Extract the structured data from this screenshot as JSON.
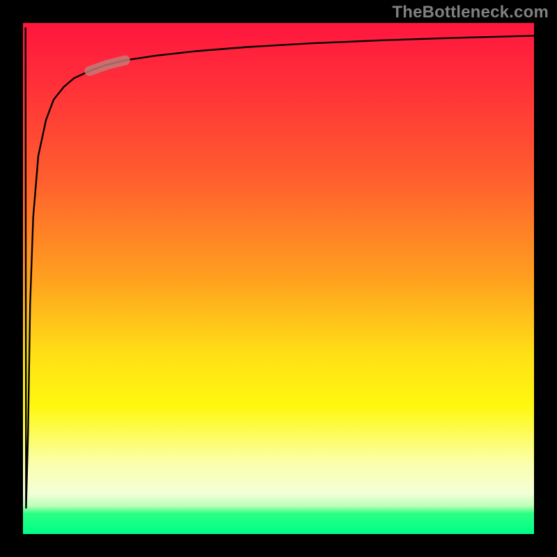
{
  "watermark": "TheBottleneck.com",
  "chart_data": {
    "type": "line",
    "title": "",
    "xlabel": "",
    "ylabel": "",
    "xlim": [
      0,
      100
    ],
    "ylim": [
      0,
      100
    ],
    "gradient_stops": [
      {
        "pos": 0,
        "color": "#ff163e"
      },
      {
        "pos": 30,
        "color": "#ff5d2f"
      },
      {
        "pos": 50,
        "color": "#ffa01f"
      },
      {
        "pos": 75,
        "color": "#fff80e"
      },
      {
        "pos": 92,
        "color": "#f4ffd8"
      },
      {
        "pos": 96,
        "color": "#2bff84"
      },
      {
        "pos": 100,
        "color": "#00ff88"
      }
    ],
    "series": [
      {
        "name": "main-curve",
        "x": [
          0.5,
          0.6,
          1.0,
          1.4,
          2.0,
          3.0,
          4.5,
          6.0,
          8.0,
          10,
          13,
          16,
          20,
          26,
          34,
          44,
          56,
          70,
          85,
          100
        ],
        "y": [
          99.0,
          5.0,
          20.0,
          45.0,
          62.0,
          74.0,
          81.0,
          85.0,
          87.5,
          89.2,
          90.6,
          91.7,
          92.7,
          93.6,
          94.5,
          95.3,
          96.0,
          96.6,
          97.1,
          97.5
        ]
      }
    ],
    "highlight_segment": {
      "series": "main-curve",
      "x_start": 13,
      "x_end": 20,
      "color": "#c27e78",
      "thickness": 14
    }
  }
}
